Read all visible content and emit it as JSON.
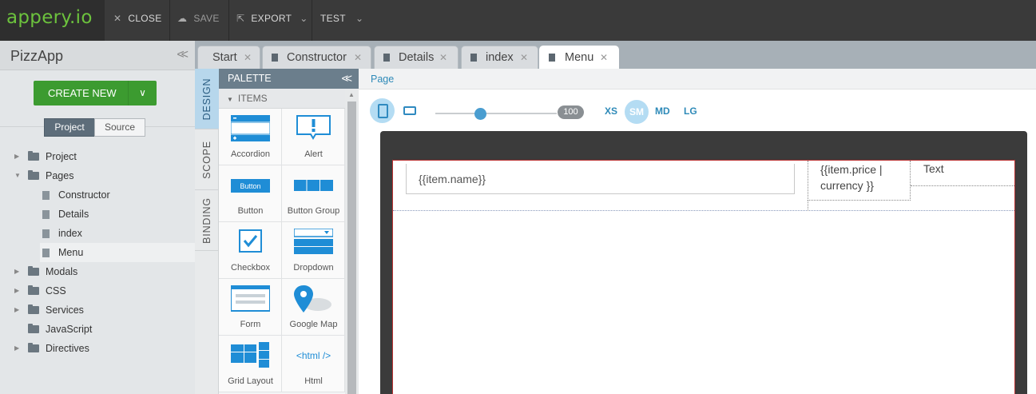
{
  "topbar": {
    "logo": "appery.io",
    "close_label": "CLOSE",
    "save_label": "SAVE",
    "export_label": "EXPORT",
    "test_label": "TEST"
  },
  "sidebar": {
    "app_name": "PizzApp",
    "create_new_label": "CREATE NEW",
    "view_toggle": {
      "project": "Project",
      "source": "Source",
      "selected": "Project"
    },
    "tree": [
      {
        "label": "Project",
        "type": "folder",
        "expanded": false
      },
      {
        "label": "Pages",
        "type": "folder",
        "expanded": true
      },
      {
        "label": "Constructor",
        "type": "page"
      },
      {
        "label": "Details",
        "type": "page"
      },
      {
        "label": "index",
        "type": "page"
      },
      {
        "label": "Menu",
        "type": "page",
        "selected": true
      },
      {
        "label": "Modals",
        "type": "folder",
        "expanded": false
      },
      {
        "label": "CSS",
        "type": "folder",
        "expanded": false
      },
      {
        "label": "Services",
        "type": "folder",
        "expanded": false
      },
      {
        "label": "JavaScript",
        "type": "folder"
      },
      {
        "label": "Directives",
        "type": "folder",
        "expanded": false
      }
    ]
  },
  "tabs": [
    {
      "label": "Start",
      "active": false
    },
    {
      "label": "Constructor",
      "active": false
    },
    {
      "label": "Details",
      "active": false
    },
    {
      "label": "index",
      "active": false
    },
    {
      "label": "Menu",
      "active": true
    }
  ],
  "side_tabs": {
    "design": "DESIGN",
    "scope": "SCOPE",
    "binding": "BINDING",
    "active": "DESIGN"
  },
  "palette": {
    "title": "PALETTE",
    "section": "ITEMS",
    "items": [
      {
        "label": "Accordion",
        "icon": "accordion-icon"
      },
      {
        "label": "Alert",
        "icon": "alert-icon"
      },
      {
        "label": "Button",
        "icon": "button-icon",
        "icon_text": "Button"
      },
      {
        "label": "Button Group",
        "icon": "button-group-icon"
      },
      {
        "label": "Checkbox",
        "icon": "checkbox-icon"
      },
      {
        "label": "Dropdown",
        "icon": "dropdown-icon"
      },
      {
        "label": "Form",
        "icon": "form-icon"
      },
      {
        "label": "Google Map",
        "icon": "map-pin-icon"
      },
      {
        "label": "Grid Layout",
        "icon": "grid-layout-icon"
      },
      {
        "label": "Html",
        "icon": "html-icon",
        "icon_text": "<html />"
      }
    ]
  },
  "canvas": {
    "breadcrumb": "Page",
    "zoom": "100",
    "zoom_fraction": 0.4,
    "breakpoints": [
      "XS",
      "SM",
      "MD",
      "LG"
    ],
    "active_breakpoint": "SM",
    "content": {
      "input_text": "{{item.name}}",
      "price_line1": "{{item.price |",
      "price_line2": "currency }}",
      "text_label": "Text"
    }
  },
  "colors": {
    "brand_green": "#6cc23d",
    "create_button": "#3c9b30",
    "accent_blue": "#2e8ab8",
    "palette_header": "#6b7e8c"
  }
}
